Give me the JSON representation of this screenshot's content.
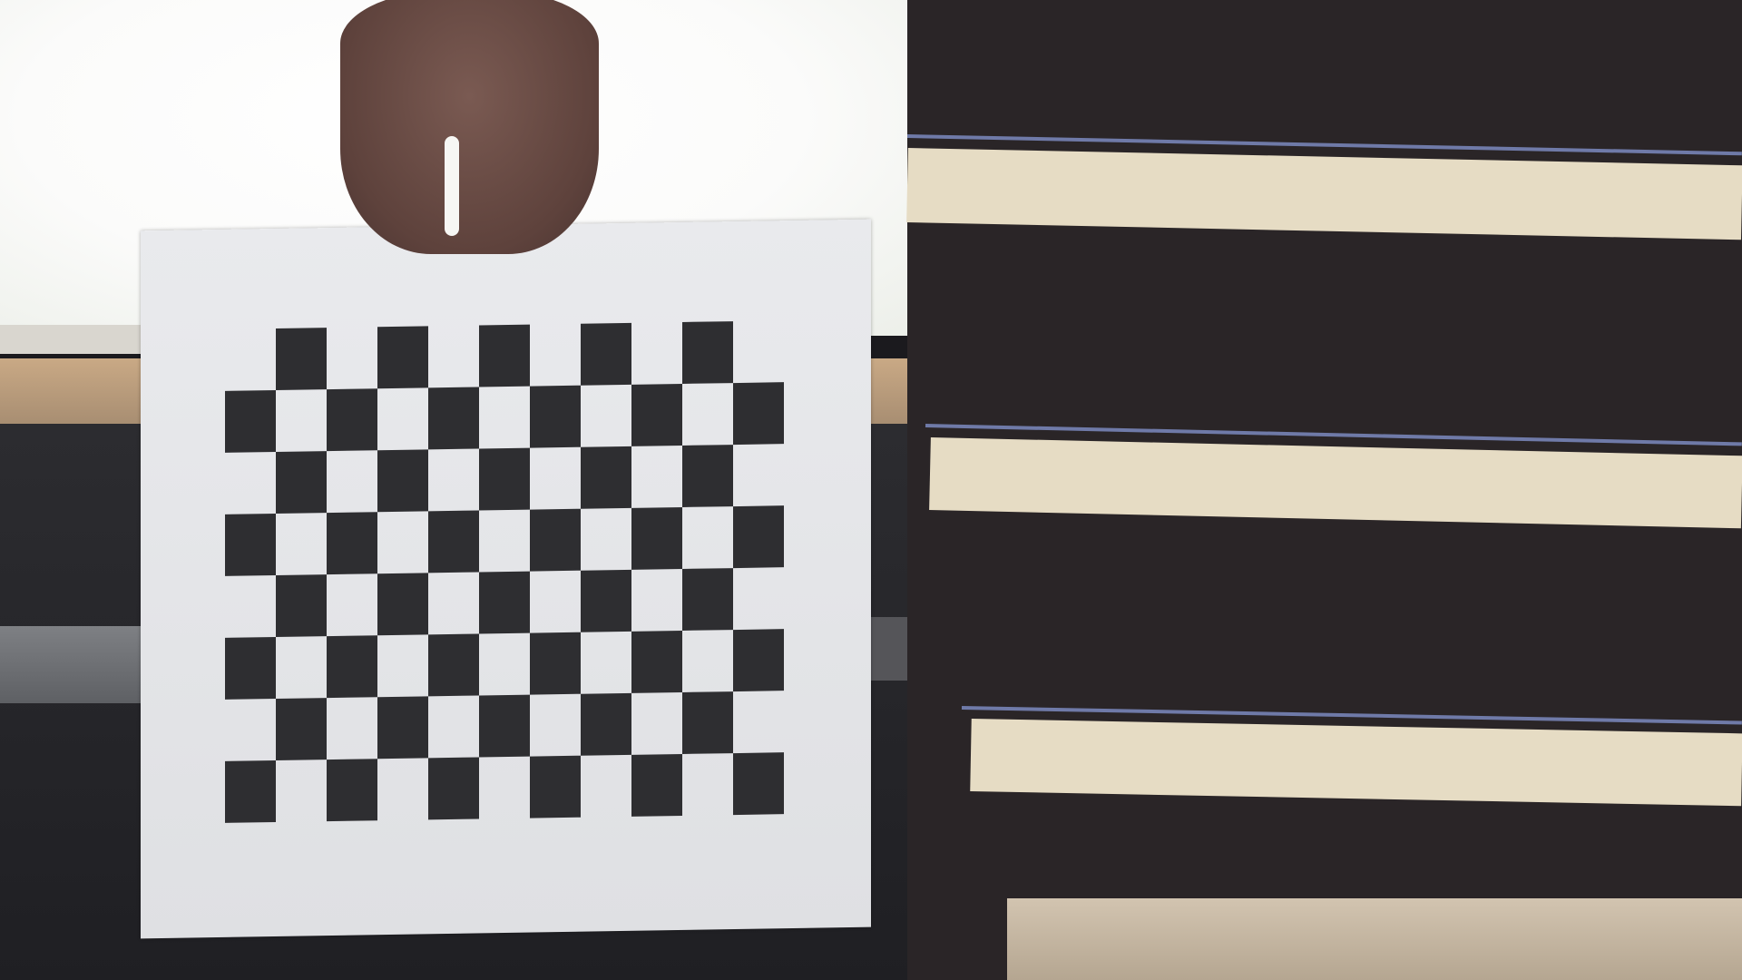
{
  "scene": {
    "description_label": "photo",
    "sheet": {
      "caption": "",
      "pattern": "checkerboard",
      "rows": 8,
      "cols": 11,
      "dark_color": "#2e2e31",
      "light_color": "#e5e6e9"
    },
    "colors": {
      "window": "#fbfbfa",
      "shirt": "#2a2527",
      "stripe": "#e6dcc4",
      "sill": "#c9a985"
    }
  }
}
